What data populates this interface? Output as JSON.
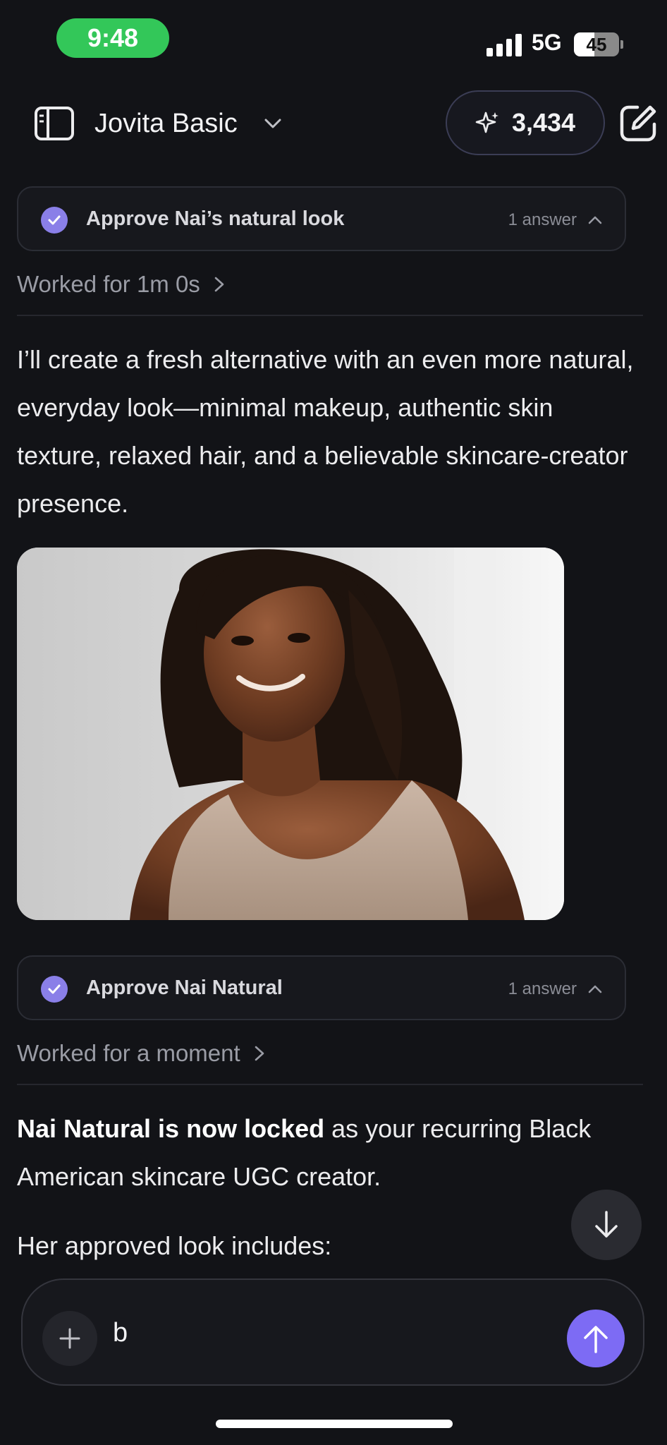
{
  "status_bar": {
    "time": "9:48",
    "network": "5G",
    "battery_text": "45",
    "battery_level": 0.45
  },
  "header": {
    "title": "Jovita Basic",
    "credits": "3,434",
    "icons": {
      "sidebar": "sidebar-icon",
      "chevron": "chevron-down-icon",
      "sparkle": "sparkle-icon",
      "compose": "compose-icon"
    }
  },
  "conversation": {
    "task1": {
      "label": "Approve Nai’s natural look",
      "answers": "1 answer"
    },
    "worked1": "Worked for 1m 0s",
    "message1": "I’ll create a fresh alternative with an even more natural, everyday look—minimal makeup, authentic skin texture, relaxed hair, and a believable skincare-creator presence.",
    "task2": {
      "label": "Approve Nai Natural",
      "answers": "1 answer"
    },
    "worked2": "Worked for a moment",
    "message2_bold": "Nai Natural is now locked",
    "message2_rest": " as your recurring Black American skincare UGC creator.",
    "message3": "Her approved look includes:"
  },
  "composer": {
    "value": "b"
  },
  "colors": {
    "background": "#121317",
    "accent": "#7D6BF4",
    "check": "#8A7FE8",
    "status_green": "#33C759"
  }
}
